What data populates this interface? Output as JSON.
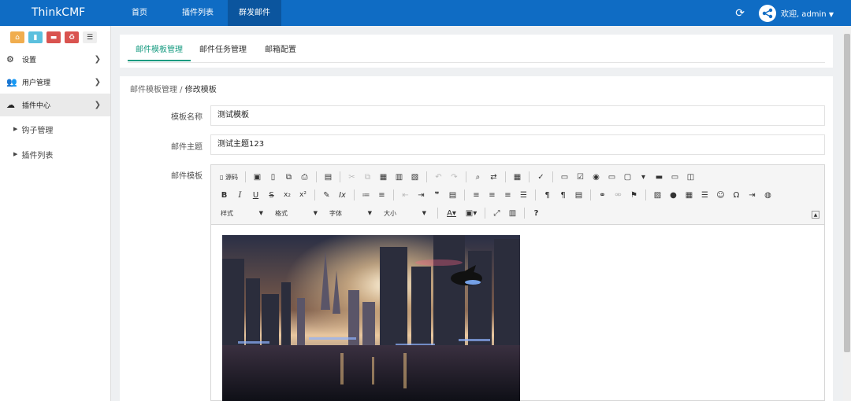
{
  "navbar": {
    "brand": "ThinkCMF",
    "items": [
      "首页",
      "插件列表",
      "群发邮件"
    ],
    "active_index": 2,
    "user_label": "欢迎, admin",
    "colors": {
      "bar": "#0f6cc4",
      "active": "#0b559e"
    }
  },
  "sidebar": {
    "quick_buttons": [
      {
        "icon": "home-icon",
        "color": "#f0ad4e"
      },
      {
        "icon": "file-icon",
        "color": "#5bc0de"
      },
      {
        "icon": "trash-icon",
        "color": "#d9534f"
      },
      {
        "icon": "recycle-icon",
        "color": "#d9534f"
      },
      {
        "icon": "list-icon",
        "color": "#eeeeee"
      }
    ],
    "items": [
      {
        "label": "设置",
        "icon": "gears-icon"
      },
      {
        "label": "用户管理",
        "icon": "users-icon"
      },
      {
        "label": "插件中心",
        "icon": "cloud-icon"
      }
    ],
    "active_index": 2,
    "sub_items": [
      "钩子管理",
      "插件列表"
    ]
  },
  "tabs": [
    "邮件模板管理",
    "邮件任务管理",
    "邮箱配置"
  ],
  "active_tab": 0,
  "breadcrumb": {
    "parent": "邮件模板管理",
    "separator": " / ",
    "current": "修改模板"
  },
  "form": {
    "name_label": "模板名称",
    "name_value": "测试模板",
    "subject_label": "邮件主题",
    "subject_value": "测试主题123",
    "template_label": "邮件模板"
  },
  "editor": {
    "source_label": "源码",
    "combos": [
      "样式",
      "格式",
      "字体",
      "大小"
    ]
  }
}
